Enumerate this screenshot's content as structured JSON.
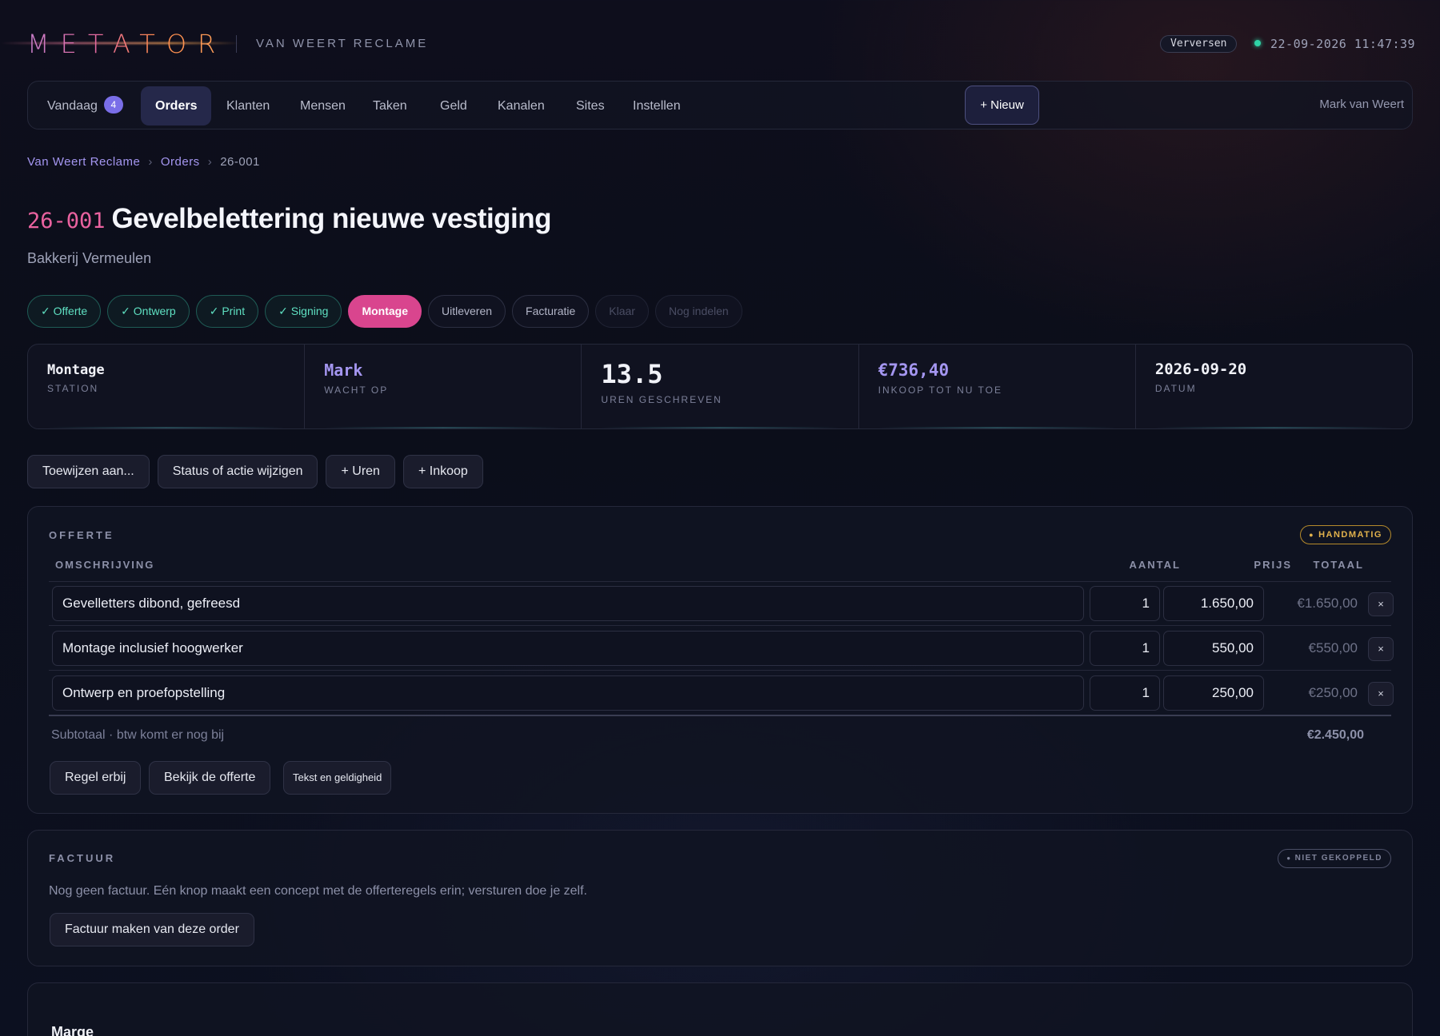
{
  "header": {
    "logo": "METATOR",
    "company": "VAN WEERT RECLAME",
    "refresh_label": "Verversen",
    "datetime": "22-09-2026 11:47:39"
  },
  "nav": {
    "items": [
      {
        "label": "Vandaag",
        "badge": "4"
      },
      {
        "label": "Orders"
      },
      {
        "label": "Klanten"
      },
      {
        "label": "Mensen"
      },
      {
        "label": "Taken"
      },
      {
        "label": "Geld"
      },
      {
        "label": "Kanalen"
      },
      {
        "label": "Sites"
      },
      {
        "label": "Instellen"
      }
    ],
    "active": "Orders",
    "new_label": "+ Nieuw",
    "user": "Mark van Weert"
  },
  "breadcrumb": [
    "Van Weert Reclame",
    "Orders",
    "26-001"
  ],
  "order": {
    "code": "26-001",
    "title": "Gevelbelettering nieuwe vestiging",
    "customer": "Bakkerij Vermeulen"
  },
  "stages": [
    {
      "label": "✓ Offerte",
      "state": "done"
    },
    {
      "label": "✓ Ontwerp",
      "state": "done"
    },
    {
      "label": "✓ Print",
      "state": "done"
    },
    {
      "label": "✓ Signing",
      "state": "done"
    },
    {
      "label": "Montage",
      "state": "current"
    },
    {
      "label": "Uitleveren",
      "state": "pending"
    },
    {
      "label": "Facturatie",
      "state": "pending"
    },
    {
      "label": "Klaar",
      "state": "future"
    },
    {
      "label": "Nog indelen",
      "state": "future"
    }
  ],
  "stats": [
    {
      "value": "Montage",
      "label": "STATION"
    },
    {
      "value": "Mark",
      "label": "WACHT OP"
    },
    {
      "value": "13.5",
      "label": "UREN GESCHREVEN"
    },
    {
      "value": "€736,40",
      "label": "INKOOP TOT NU TOE"
    },
    {
      "value": "2026-09-20",
      "label": "DATUM"
    }
  ],
  "actions": [
    "Toewijzen aan...",
    "Status of actie wijzigen",
    "+ Uren",
    "+ Inkoop"
  ],
  "quote": {
    "title": "OFFERTE",
    "badge": "HANDMATIG",
    "columns": {
      "desc": "OMSCHRIJVING",
      "qty": "AANTAL",
      "price": "PRIJS",
      "total": "TOTAAL"
    },
    "rows": [
      {
        "desc": "Gevelletters dibond, gefreesd",
        "qty": "1",
        "price": "1.650,00",
        "total": "€1.650,00"
      },
      {
        "desc": "Montage inclusief hoogwerker",
        "qty": "1",
        "price": "550,00",
        "total": "€550,00"
      },
      {
        "desc": "Ontwerp en proefopstelling",
        "qty": "1",
        "price": "250,00",
        "total": "€250,00"
      }
    ],
    "delete_symbol": "×",
    "subtotal_label": "Subtotaal · btw komt er nog bij",
    "subtotal_value": "€2.450,00",
    "buttons": {
      "add_line": "Regel erbij",
      "view_quote": "Bekijk de offerte",
      "text_validity": "Tekst en geldigheid"
    }
  },
  "invoice": {
    "title": "FACTUUR",
    "badge": "NIET GEKOPPELD",
    "text": "Nog geen factuur. Eén knop maakt een concept met de offerteregels erin; versturen doe je zelf.",
    "button": "Factuur maken van deze order"
  },
  "margin": {
    "title": "Marge"
  },
  "colors": {
    "accent_pink": "#d9458e",
    "accent_purple": "#a496f0",
    "done_green": "#5fe0c2",
    "manual_amber": "#e2b24c",
    "live_green": "#2fd3a6"
  }
}
